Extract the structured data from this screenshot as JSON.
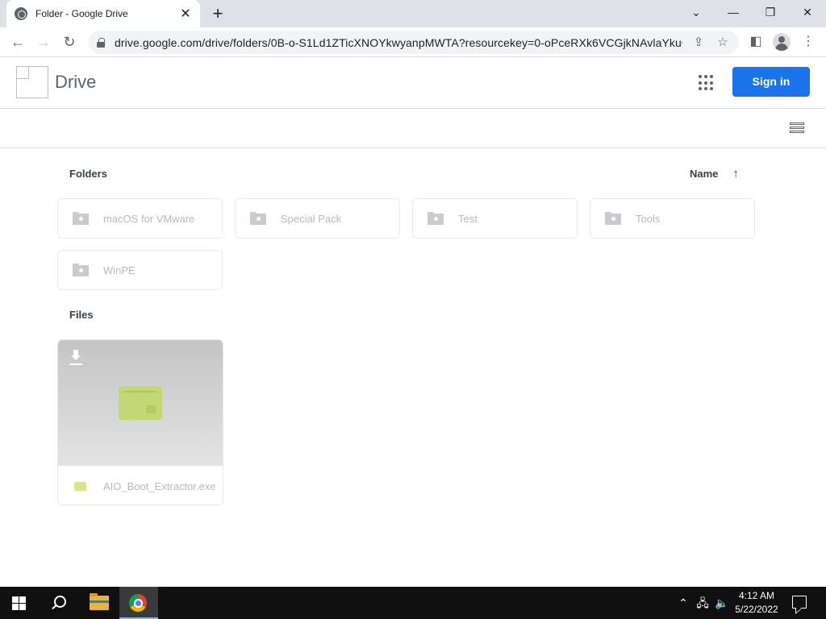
{
  "browser": {
    "tab_title": "Folder - Google Drive",
    "tab_close": "✕",
    "new_tab": "+",
    "url": "drive.google.com/drive/folders/0B-o-S1Ld1ZTicXNOYkwyanpMWTA?resourcekey=0-oPceRXk6VCGjkNAvlaYkuQ",
    "window_controls": {
      "tab_search": "⌄",
      "minimize": "—",
      "restore": "❐",
      "close": "✕"
    },
    "nav": {
      "back": "←",
      "forward": "→",
      "reload": "↻"
    }
  },
  "drive": {
    "title": "Drive",
    "sign_in_label": "Sign in",
    "folders_label": "Folders",
    "files_label": "Files",
    "sort_label": "Name",
    "sort_arrow": "↑",
    "folders": [
      "macOS for VMware",
      "Special Pack",
      "Test",
      "Tools",
      "WinPE"
    ],
    "files": [
      {
        "name": "AIO_Boot_Extractor.exe",
        "type_color": "#c3d773"
      }
    ]
  },
  "taskbar": {
    "time": "4:12 AM",
    "date": "5/22/2022",
    "tray_chevron": "⌃"
  },
  "colors": {
    "accent": "#1a73e8",
    "tab_strip": "#dee1e6",
    "taskbar": "#101010"
  }
}
